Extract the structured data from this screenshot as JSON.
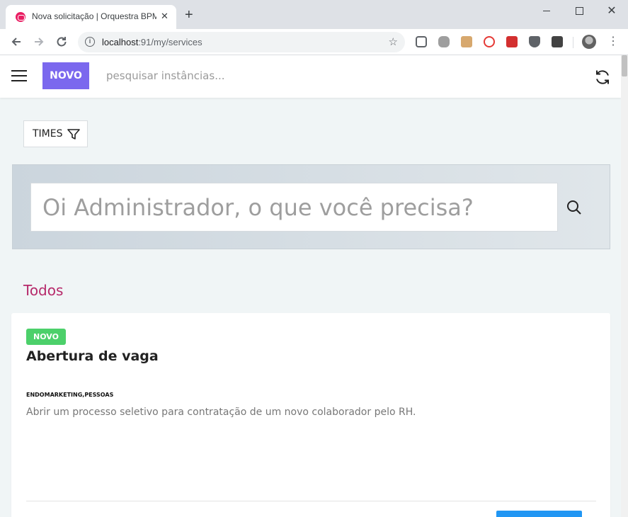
{
  "browser": {
    "tab_title": "Nova solicitação | Orquestra BPM",
    "tab_close": "✕",
    "new_tab": "+",
    "url_host": "localhost",
    "url_rest": ":91/my/services",
    "window_close": "✕"
  },
  "header": {
    "new_button_label": "NOVO",
    "search_placeholder": "pesquisar instâncias..."
  },
  "filter": {
    "label": "TIMES"
  },
  "hero": {
    "search_placeholder": "Oi Administrador, o que você precisa?"
  },
  "section": {
    "title": "Todos"
  },
  "services": [
    {
      "badge": "NOVO",
      "title": "Abertura de vaga",
      "tags": "ENDOMARKETING,PESSOAS",
      "description": "Abrir um processo seletivo para contratação de um novo colaborador pelo RH."
    }
  ],
  "colors": {
    "brand_purple": "#7b68ee",
    "section_title": "#b6296a",
    "badge_green": "#4cd06a",
    "action_blue": "#2196f3"
  }
}
